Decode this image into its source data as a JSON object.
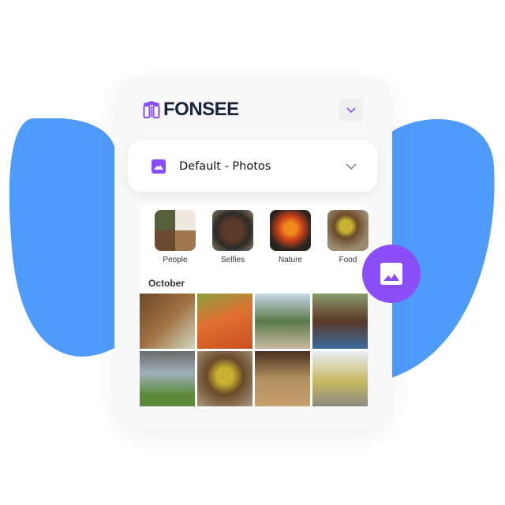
{
  "app": {
    "brand": "FONSEE"
  },
  "colors": {
    "accent": "#8b4df7",
    "blob": "#4f9bfb",
    "brand_text": "#17243a"
  },
  "header": {
    "menu_icon": "chevron-down-icon"
  },
  "album_select": {
    "selected": "Default - Photos",
    "icon": "image-icon"
  },
  "categories": [
    {
      "label": "People"
    },
    {
      "label": "Selfies"
    },
    {
      "label": "Nature"
    },
    {
      "label": "Food"
    }
  ],
  "section": {
    "month": "October"
  },
  "fab": {
    "icon": "image-icon"
  }
}
